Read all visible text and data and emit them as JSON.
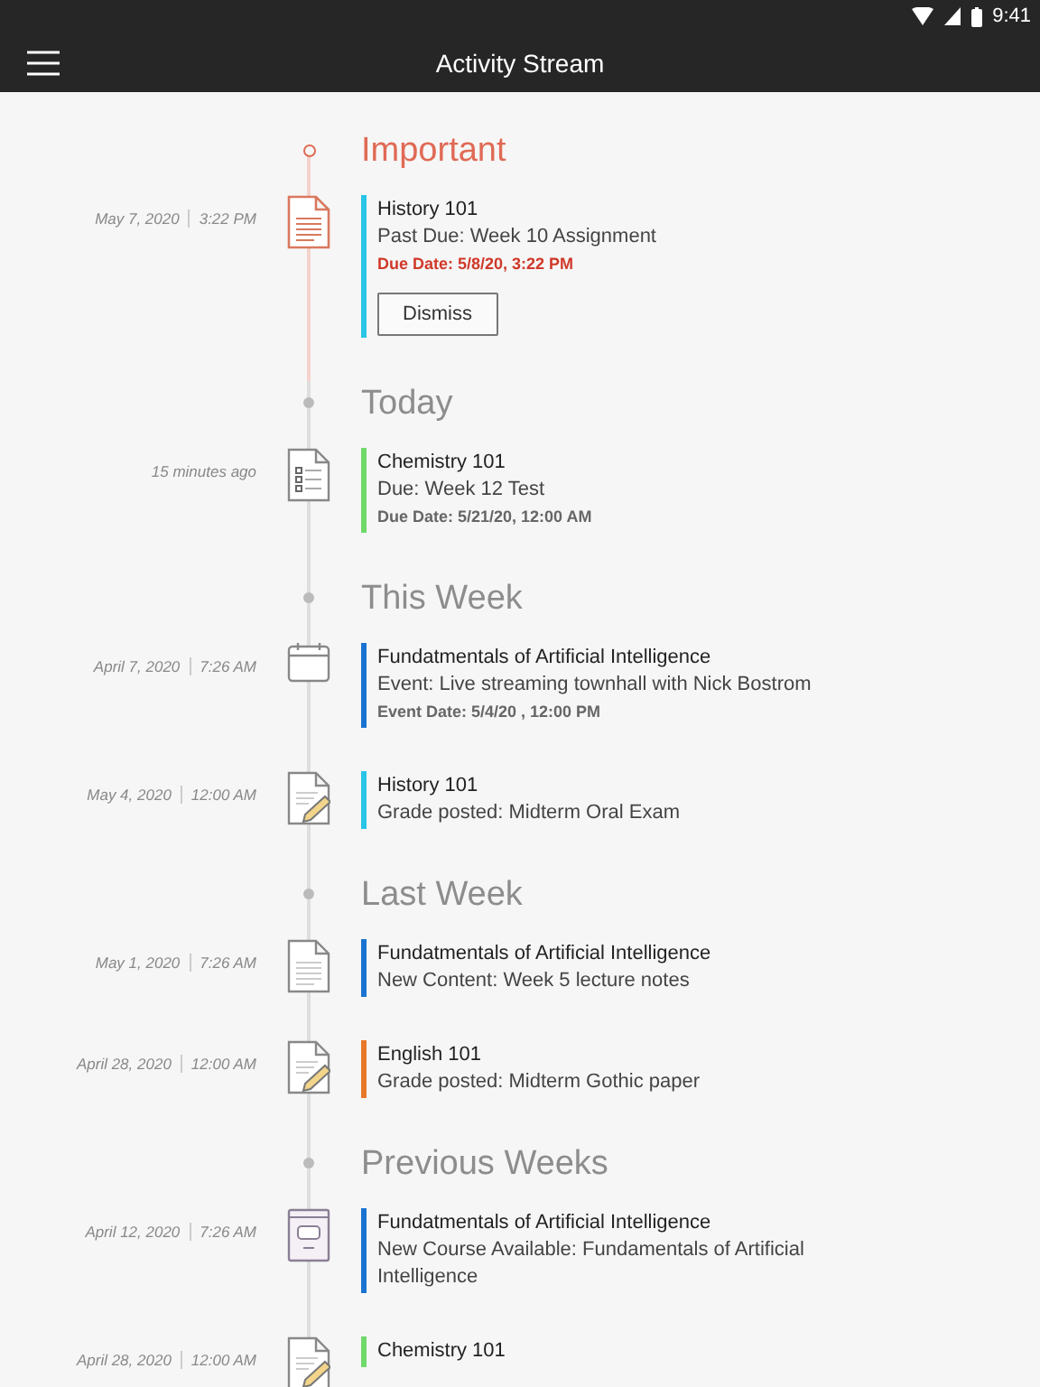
{
  "status_bar": {
    "time": "9:41"
  },
  "app_bar": {
    "title": "Activity Stream"
  },
  "sections": [
    {
      "heading": "Important",
      "highlighted": true,
      "items": [
        {
          "date": "May 7, 2020",
          "time": "3:22 PM",
          "kind": "assignment",
          "color": "#29c5e6",
          "course": "History 101",
          "detail": "Past Due: Week 10 Assignment",
          "meta": "Due Date: 5/8/20, 3:22 PM",
          "urgent": true,
          "action": "Dismiss"
        }
      ]
    },
    {
      "heading": "Today",
      "highlighted": false,
      "items": [
        {
          "date": "15 minutes ago",
          "kind": "test",
          "color": "#6fd96a",
          "course": "Chemistry 101",
          "detail": "Due: Week 12 Test",
          "meta": "Due Date: 5/21/20, 12:00 AM",
          "urgent": false
        }
      ]
    },
    {
      "heading": "This Week",
      "highlighted": false,
      "items": [
        {
          "date": "April 7, 2020",
          "time": "7:26 AM",
          "kind": "event",
          "color": "#1a73d1",
          "course": "Fundatmentals of Artificial Intelligence",
          "detail": "Event: Live streaming townhall with Nick Bostrom",
          "meta": "Event Date: 5/4/20 , 12:00 PM",
          "urgent": false
        },
        {
          "date": "May 4, 2020",
          "time": "12:00 AM",
          "kind": "grade",
          "color": "#29c5e6",
          "course": "History 101",
          "detail": "Grade posted: Midterm Oral Exam"
        }
      ]
    },
    {
      "heading": "Last Week",
      "highlighted": false,
      "items": [
        {
          "date": "May 1, 2020",
          "time": "7:26 AM",
          "kind": "content",
          "color": "#1a73d1",
          "course": "Fundatmentals of Artificial Intelligence",
          "detail": "New Content: Week 5 lecture notes"
        },
        {
          "date": "April 28, 2020",
          "time": "12:00 AM",
          "kind": "grade",
          "color": "#e8792a",
          "course": "English 101",
          "detail": "Grade posted: Midterm Gothic paper"
        }
      ]
    },
    {
      "heading": "Previous Weeks",
      "highlighted": false,
      "items": [
        {
          "date": "April 12, 2020",
          "time": "7:26 AM",
          "kind": "course",
          "color": "#1a73d1",
          "course": "Fundatmentals of Artificial Intelligence",
          "detail": "New Course Available: Fundamentals of Artificial Intelligence"
        },
        {
          "date": "April 28, 2020",
          "time": "12:00 AM",
          "kind": "grade",
          "color": "#6fd96a",
          "course": "Chemistry 101"
        }
      ]
    }
  ]
}
